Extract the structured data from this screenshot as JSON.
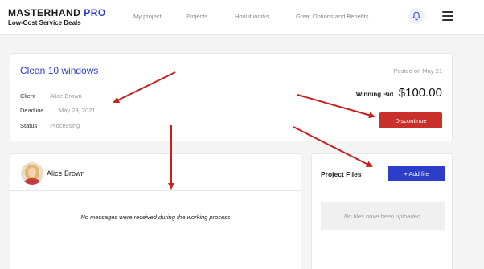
{
  "header": {
    "brand": "MASTERHAND",
    "brand_accent": "PRO",
    "tagline": "Low-Cost Service Deals",
    "nav": [
      "My project",
      "Projects",
      "How it works",
      "Great Options and Benefits"
    ],
    "icons": [
      "bell-icon",
      "hamburger-menu-icon"
    ]
  },
  "task": {
    "title": "Clean 10 windows",
    "posted": "Posted on May 21",
    "client_label": "Client",
    "client_value": "Alice Brown",
    "deadline_label": "Deadline",
    "deadline_value": "May 23, 2021",
    "status_label": "Status",
    "status_value": "Processing",
    "winning_bid_label": "Winning Bid",
    "winning_bid_value": "$100.00",
    "discontinue_label": "Discontinue"
  },
  "messages": {
    "contact_name": "Alice Brown",
    "empty_text": "No messages were received during the working process"
  },
  "files": {
    "title": "Project Files",
    "add_label": "+ Add file",
    "empty_text": "No files have been uploaded."
  },
  "colors": {
    "brand_blue": "#2c3ec9",
    "danger_red": "#c9302c",
    "annotation_arrow": "#c62020"
  }
}
